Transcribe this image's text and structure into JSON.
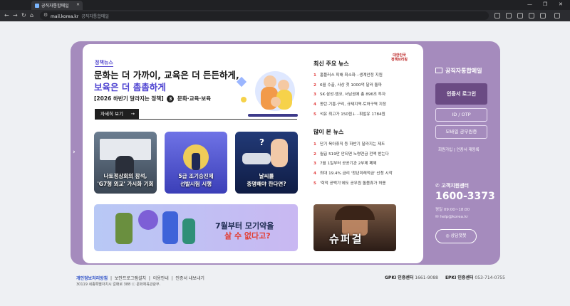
{
  "browser": {
    "tab_title": "공직자통합메일",
    "url": "mail.korea.kr",
    "page_title": "공직자통합메일"
  },
  "hero": {
    "tag": "정책뉴스",
    "title_line1": "문화는 더 가까이, 교육은 더 든든하게,",
    "title_line2": "보육은 더 촘촘하게",
    "subtitle_prefix": "[2026 하반기 달라지는 정책]",
    "subtitle_num": "3",
    "subtitle_suffix": "문화·교육·보육",
    "detail_button": "자세히 보기"
  },
  "thumbnails": [
    {
      "caption_l1": "나토정상회의 참석,",
      "caption_l2": "'G7형 외교' 가시화 기회"
    },
    {
      "caption_l1": "5급 조기승진제",
      "caption_l2": "선발시험 시행"
    },
    {
      "caption_l1": "날씨를",
      "caption_l2": "중명해야 한다면?"
    }
  ],
  "banner": {
    "line1": "7월부터 모기약을",
    "line2": "살 수 없다고?"
  },
  "logo_text": {
    "l1": "대한민국",
    "l2": "정책브리핑"
  },
  "top_news": {
    "title": "최신 주요 뉴스",
    "items": [
      {
        "n": "1",
        "text": "홈플러스 피해 최소화···생계안정 지원"
      },
      {
        "n": "2",
        "text": "6월 수출, 사상 첫 1000억 달러 돌파"
      },
      {
        "n": "3",
        "text": "SK·삼성·엠코, 서남권에 총 896조 투자"
      },
      {
        "n": "4",
        "text": "동탄·기흥·구리, 규제지역·토허구역 지정"
      },
      {
        "n": "5",
        "text": "석유 최고가 150원↓···휘발유 1784원"
      }
    ]
  },
  "most_viewed": {
    "title": "많이 본 뉴스",
    "items": [
      {
        "n": "1",
        "text": "단기 육아휴직 등 하반기 달라지는 제도"
      },
      {
        "n": "2",
        "text": "월급 519만 안되면 노령연금 전액 받는다"
      },
      {
        "n": "3",
        "text": "7월 1일부터 공공기관 2부제 폐제"
      },
      {
        "n": "4",
        "text": "최대 19.4% 금리 '청년미래적금' 신청 시작"
      },
      {
        "n": "5",
        "text": "'학적 공백기'에도 공무원 돌봄휴가 허용"
      }
    ]
  },
  "movie": {
    "title": "슈퍼걸"
  },
  "login_panel": {
    "brand": "공직자통합메일",
    "login_button": "인증서 로그인",
    "id_button": "ID / OTP",
    "mobile_button": "모바일 공무원증",
    "links": "회원가입  |  인증서 재등록",
    "cs_title": "고객지원센터",
    "cs_phone": "1600-3373",
    "cs_hours": "평일 09:00~18:00",
    "cs_email": "help@korea.kr",
    "chatbot": "상담챗봇"
  },
  "footer": {
    "privacy": "개인정보처리방침",
    "link2": "보안프로그램설치",
    "link3": "이용안내",
    "link4": "인증서 내보내기",
    "address": "30119 세종특별자치시 갈매로 388   ⓒ 문화체육관광부.",
    "gpki_label": "GPKI 인증센터",
    "gpki_phone": "1661-9088",
    "epki_label": "EPKI 인증센터",
    "epki_phone": "053-714-0755"
  }
}
